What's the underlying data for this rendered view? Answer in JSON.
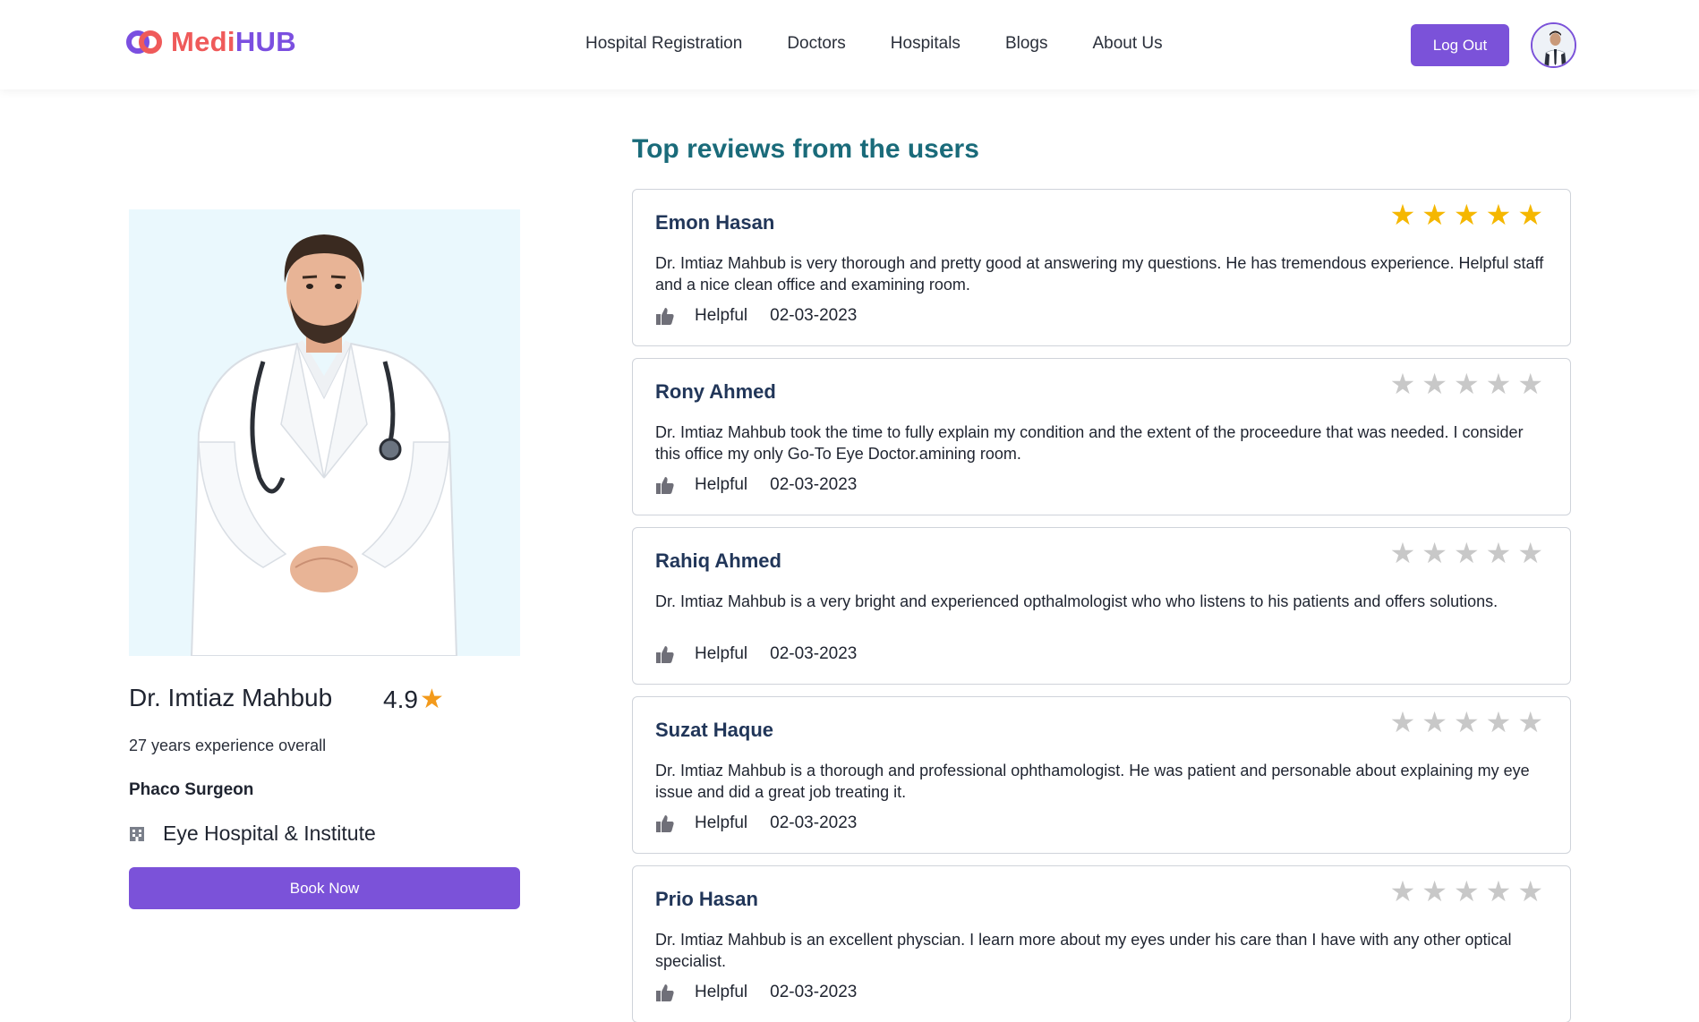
{
  "brand": {
    "part1": "Medi",
    "part2": "HUB"
  },
  "nav": [
    {
      "label": "Hospital Registration"
    },
    {
      "label": "Doctors"
    },
    {
      "label": "Hospitals"
    },
    {
      "label": "Blogs"
    },
    {
      "label": "About Us"
    }
  ],
  "header": {
    "logout_label": "Log Out"
  },
  "doctor": {
    "name": "Dr. Imtiaz Mahbub",
    "rating": "4.9",
    "experience": "27 years experience overall",
    "specialty": "Phaco Surgeon",
    "hospital": "Eye Hospital & Institute",
    "book_label": "Book Now"
  },
  "reviews_title": "Top reviews from the users",
  "reviews": [
    {
      "name": "Emon Hasan",
      "stars": 5,
      "text": "Dr. Imtiaz Mahbub is very thorough and pretty good at answering my questions. He has tremendous experience. Helpful staff and a nice clean office and examining room.",
      "helpful": "Helpful",
      "date": "02-03-2023"
    },
    {
      "name": "Rony Ahmed",
      "stars": 0,
      "text": "Dr. Imtiaz Mahbub took the time to fully explain my condition and the extent of the proceedure that was needed. I consider this office my only Go-To Eye Doctor.amining room.",
      "helpful": "Helpful",
      "date": "02-03-2023"
    },
    {
      "name": "Rahiq Ahmed",
      "stars": 0,
      "text": "Dr. Imtiaz Mahbub is a very bright and experienced opthalmologist who who listens to his patients and offers solutions.",
      "helpful": "Helpful",
      "date": "02-03-2023"
    },
    {
      "name": "Suzat Haque",
      "stars": 0,
      "text": "Dr. Imtiaz Mahbub is a thorough and professional ophthamologist. He was patient and personable about explaining my eye issue and did a great job treating it.",
      "helpful": "Helpful",
      "date": "02-03-2023"
    },
    {
      "name": "Prio Hasan",
      "stars": 0,
      "text": "Dr. Imtiaz Mahbub is an excellent physcian. I learn more about my eyes under his care than I have with any other optical specialist.",
      "helpful": "Helpful",
      "date": "02-03-2023"
    }
  ],
  "colors": {
    "accent": "#7b52d9",
    "title_teal": "#1a6b7a",
    "star_gold": "#f5b700",
    "star_gray": "#c8c8c8"
  },
  "icons": {
    "like": "thumbs-up-icon",
    "hospital": "hospital-icon",
    "rating": "star-icon"
  }
}
